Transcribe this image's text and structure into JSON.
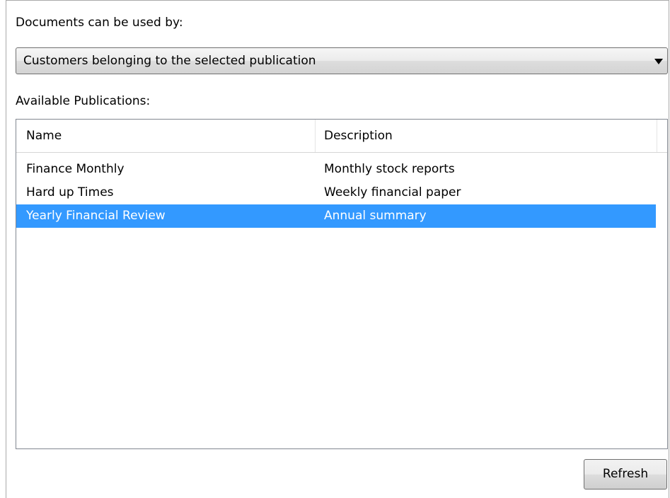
{
  "usage": {
    "label": "Documents can be used by:",
    "selected_option": "Customers belonging to the selected publication"
  },
  "publications": {
    "label": "Available Publications:",
    "columns": [
      "Name",
      "Description"
    ],
    "rows": [
      {
        "name": "Finance Monthly",
        "description": "Monthly stock reports",
        "selected": false
      },
      {
        "name": "Hard up Times",
        "description": "Weekly financial paper",
        "selected": false
      },
      {
        "name": "Yearly Financial Review",
        "description": "Annual summary",
        "selected": true
      }
    ]
  },
  "actions": {
    "refresh_label": "Refresh"
  },
  "colors": {
    "selection": "#3399ff",
    "selection_text": "#ffffff"
  },
  "icons": {
    "combo_arrow": "dropdown-arrow-icon"
  }
}
